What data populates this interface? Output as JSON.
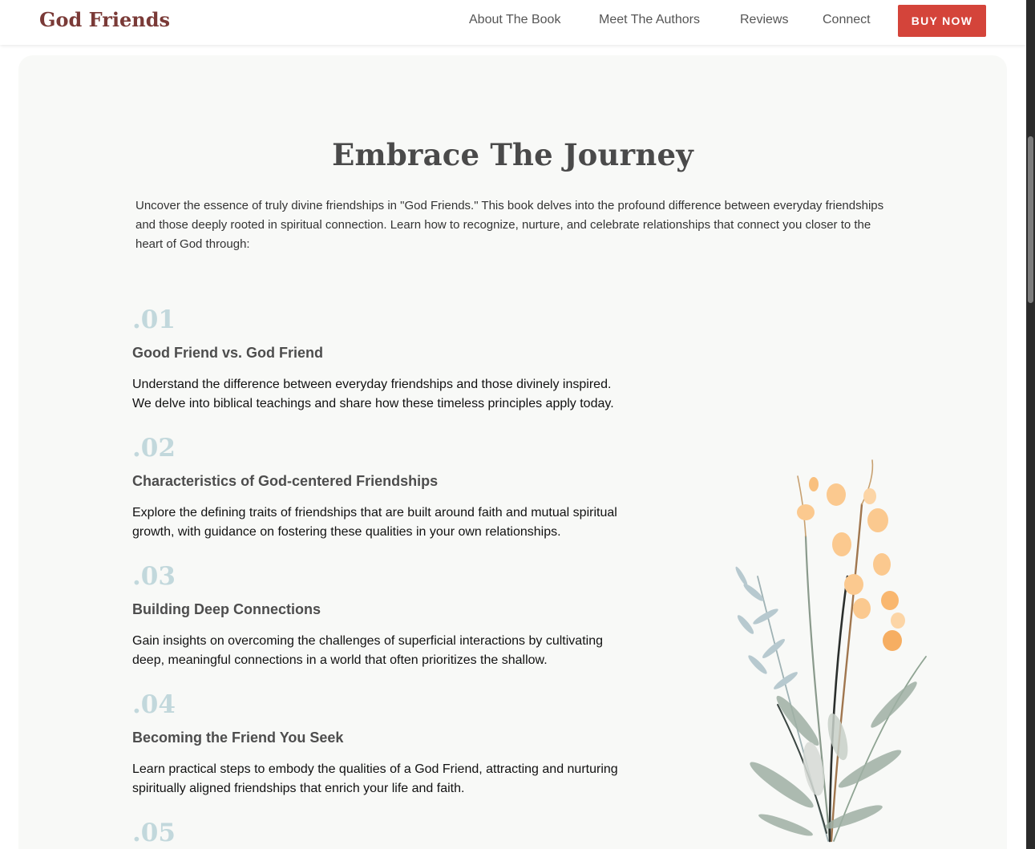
{
  "header": {
    "logo": "God Friends",
    "nav": [
      {
        "label": "About The Book"
      },
      {
        "label": "Meet The Authors"
      },
      {
        "label": "Reviews"
      },
      {
        "label": "Connect"
      }
    ],
    "cta_label": "BUY NOW"
  },
  "main": {
    "title": "Embrace The Journey",
    "intro": "Uncover the essence of truly divine friendships in \"God Friends.\" This book delves into the profound difference between everyday friendships and those deeply rooted in spiritual connection. Learn how to recognize, nurture, and celebrate relationships that connect you closer to the heart of God through:",
    "features": [
      {
        "num": ".01",
        "title": "Good Friend vs. God Friend",
        "desc": "Understand the difference between everyday friendships and those divinely inspired. We delve into biblical teachings and share how these timeless principles apply today."
      },
      {
        "num": ".02",
        "title": "Characteristics of God-centered Friendships",
        "desc": "Explore the defining traits of friendships that are built around faith and mutual spiritual growth, with guidance on fostering these qualities in your own relationships."
      },
      {
        "num": ".03",
        "title": "Building Deep Connections",
        "desc": "Gain insights on overcoming the challenges of superficial interactions by cultivating deep, meaningful connections in a world that often prioritizes the shallow."
      },
      {
        "num": ".04",
        "title": "Becoming the Friend You Seek",
        "desc": "Learn practical steps to embody the qualities of a God Friend, attracting and nurturing spiritually aligned friendships that enrich your life and faith."
      },
      {
        "num": ".05"
      }
    ]
  },
  "colors": {
    "logo": "#7a3a37",
    "cta": "#d4443a",
    "number": "#c2d8dc",
    "card_bg": "#f8f9f7"
  },
  "icons": {
    "illustration": "wildflower-bouquet-illustration"
  }
}
